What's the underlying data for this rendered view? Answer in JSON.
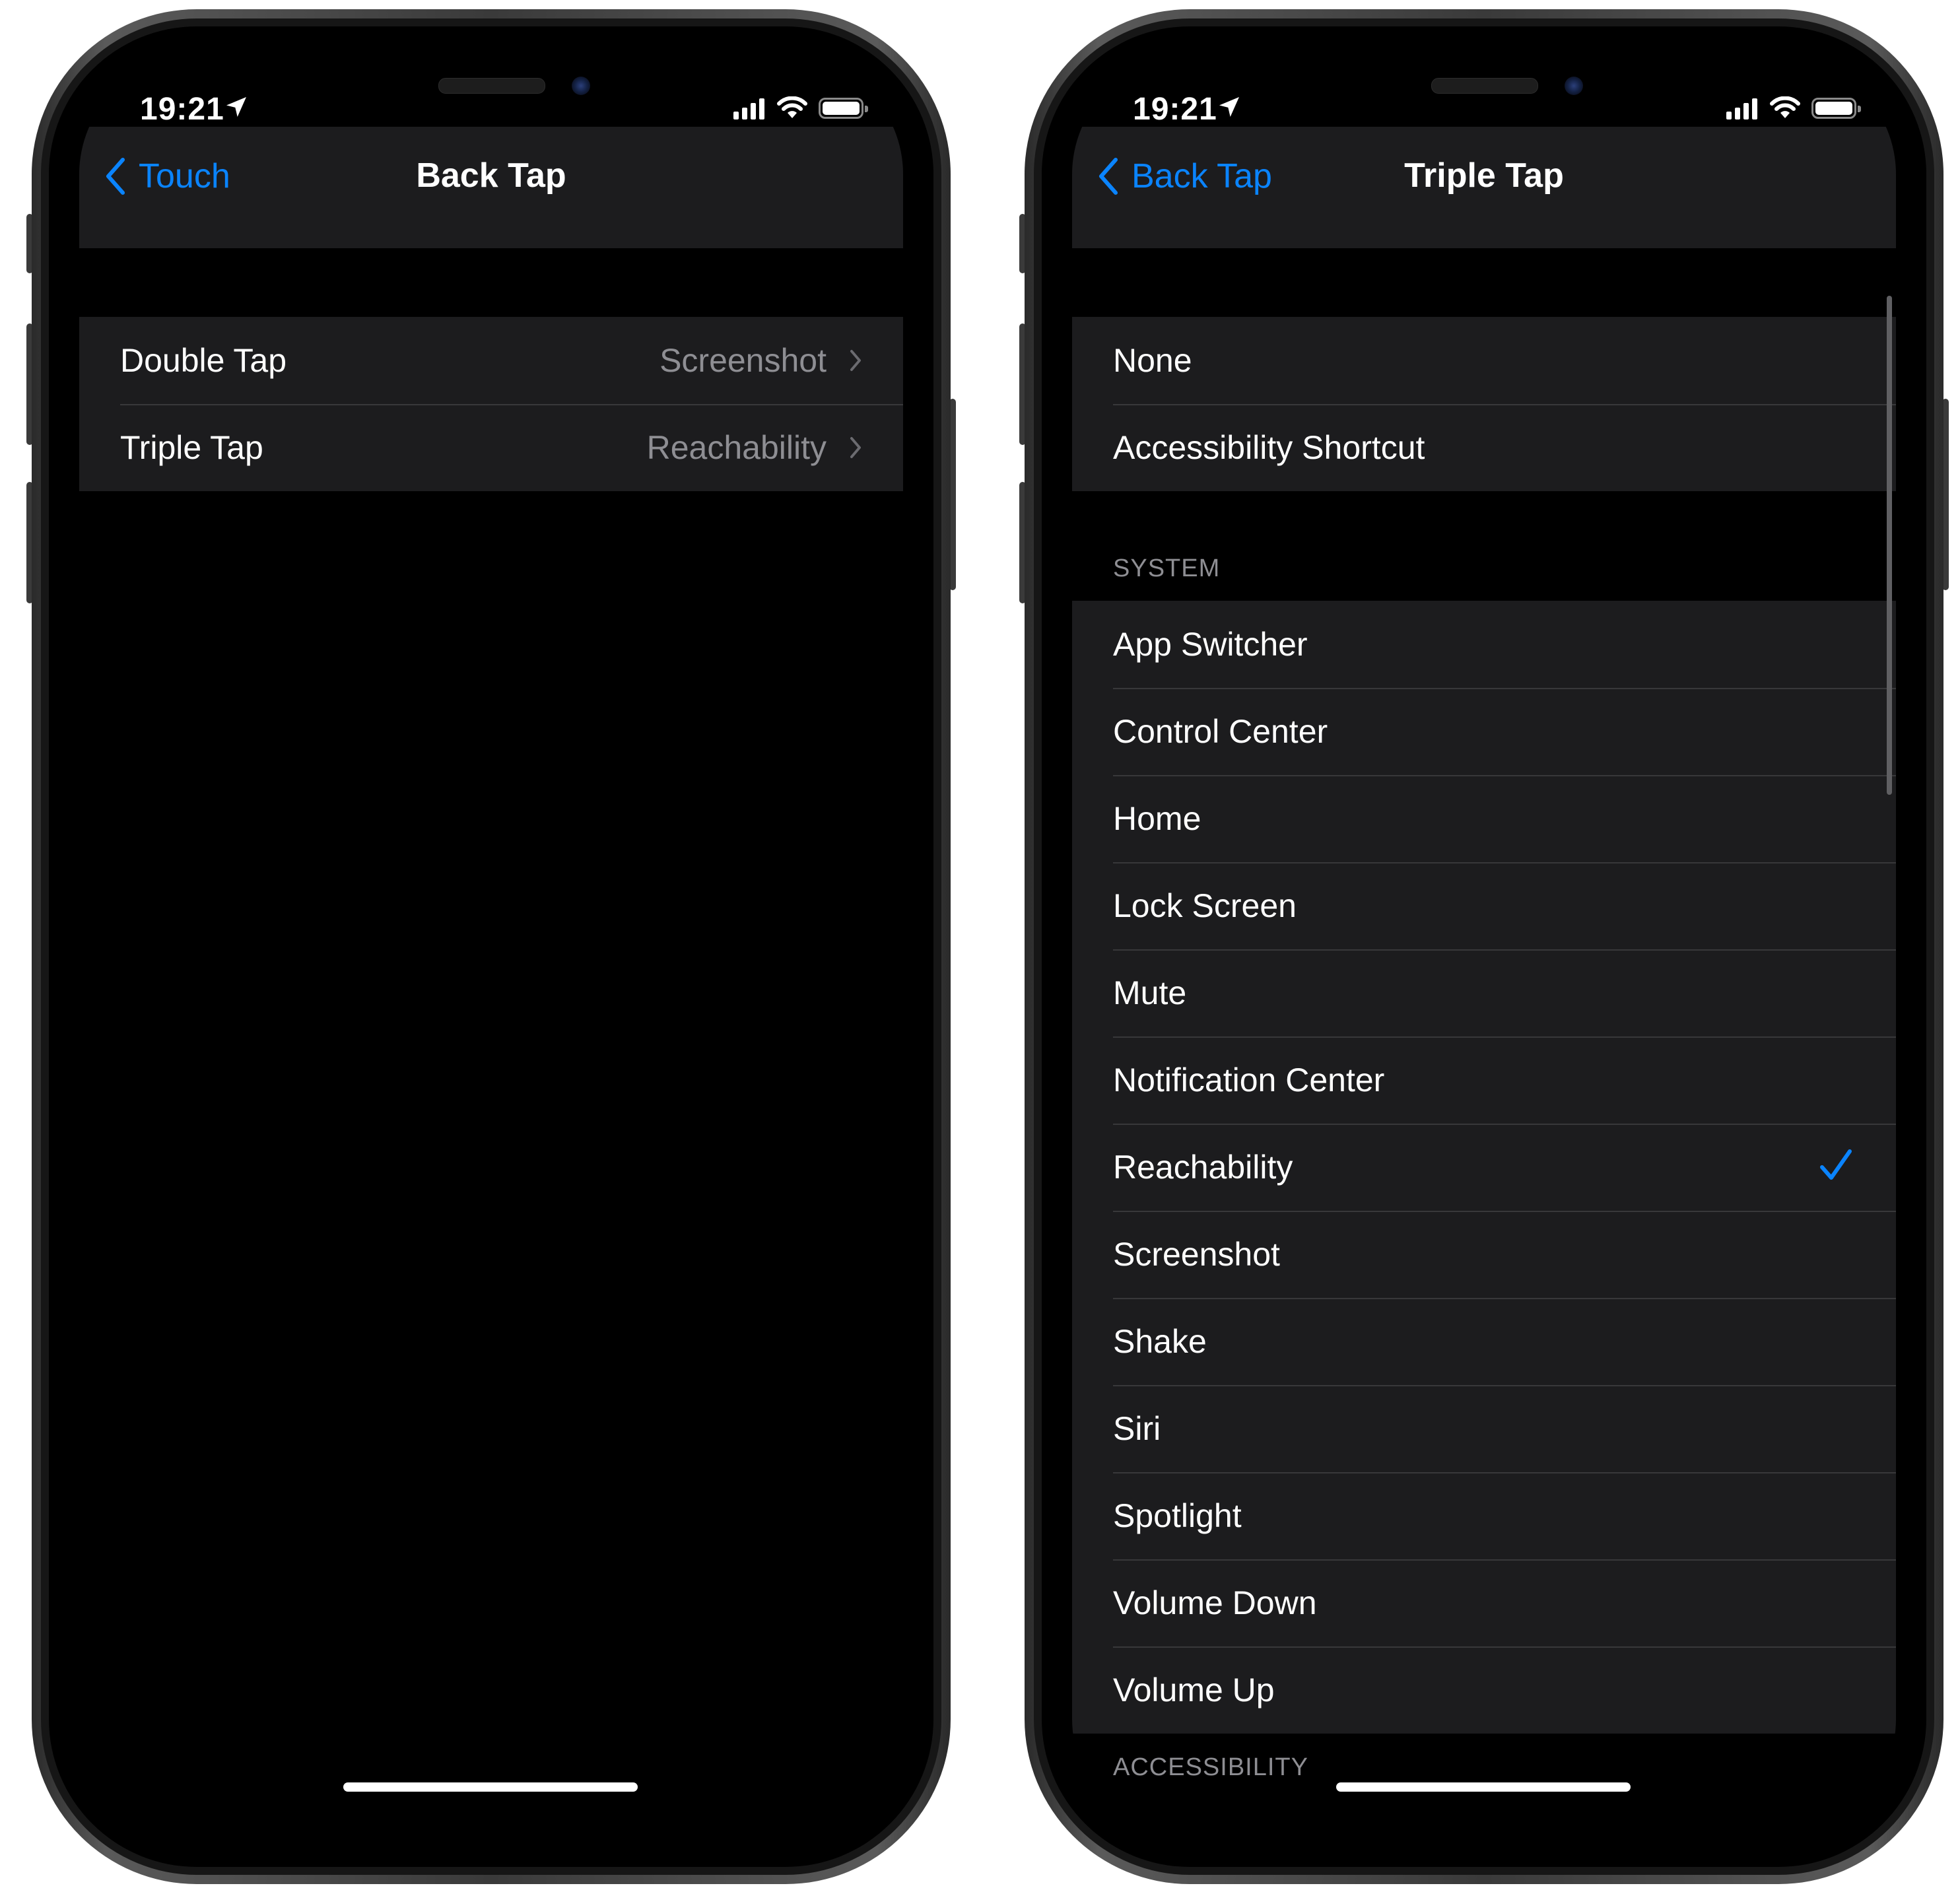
{
  "left_phone": {
    "status": {
      "time": "19:21"
    },
    "nav": {
      "back_label": "Touch",
      "title": "Back Tap"
    },
    "rows": [
      {
        "label": "Double Tap",
        "value": "Screenshot"
      },
      {
        "label": "Triple Tap",
        "value": "Reachability"
      }
    ]
  },
  "right_phone": {
    "status": {
      "time": "19:21"
    },
    "nav": {
      "back_label": "Back Tap",
      "title": "Triple Tap"
    },
    "top_options": [
      "None",
      "Accessibility Shortcut"
    ],
    "system_header": "SYSTEM",
    "system_options": [
      "App Switcher",
      "Control Center",
      "Home",
      "Lock Screen",
      "Mute",
      "Notification Center",
      "Reachability",
      "Screenshot",
      "Shake",
      "Siri",
      "Spotlight",
      "Volume Down",
      "Volume Up"
    ],
    "selected_option": "Reachability",
    "accessibility_header": "ACCESSIBILITY"
  },
  "colors": {
    "accent": "#0a84ff",
    "cell_background": "#1c1c1e",
    "secondary_text": "#8e8e93",
    "separator": "#38383a"
  },
  "icons": {
    "back": "chevron-left-icon",
    "disclosure": "chevron-right-icon",
    "selected": "checkmark-icon",
    "location": "location-arrow-icon",
    "signal": "cellular-signal-icon",
    "wifi": "wifi-icon",
    "battery": "battery-icon"
  }
}
